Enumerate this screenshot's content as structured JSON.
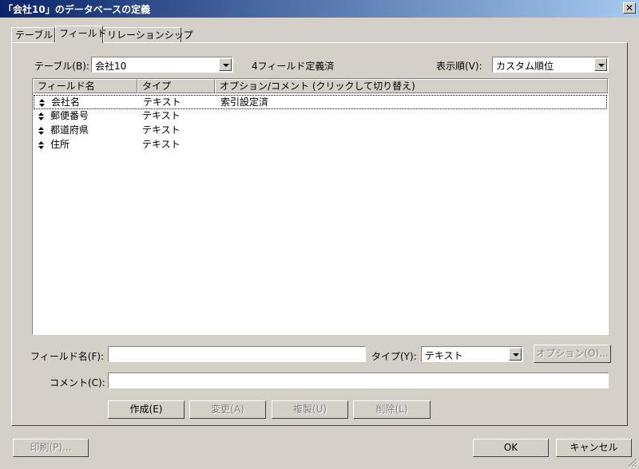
{
  "window": {
    "title": "「会社10」のデータベースの定義",
    "close_glyph": "✕"
  },
  "tabs": [
    {
      "label": "テーブル",
      "active": false
    },
    {
      "label": "フィールド",
      "active": true
    },
    {
      "label": "リレーションシップ",
      "active": false
    }
  ],
  "table_selector": {
    "label": "テーブル(B):",
    "value": "会社10"
  },
  "field_count": "4フィールド定義済",
  "sort_order": {
    "label": "表示順(V):",
    "value": "カスタム順位"
  },
  "field_list": {
    "columns": [
      "フィールド名",
      "タイプ",
      "オプション/コメント  (クリックして切り替え)"
    ],
    "rows": [
      {
        "name": "会社名",
        "type": "テキスト",
        "options": "索引設定済",
        "selected": true
      },
      {
        "name": "郵便番号",
        "type": "テキスト",
        "options": ""
      },
      {
        "name": "都道府県",
        "type": "テキスト",
        "options": ""
      },
      {
        "name": "住所",
        "type": "テキスト",
        "options": ""
      }
    ]
  },
  "field_name": {
    "label": "フィールド名(F):",
    "value": ""
  },
  "type_selector": {
    "label": "タイプ(Y):",
    "value": "テキスト"
  },
  "options_button": "オプション(O)...",
  "comment": {
    "label": "コメント(C):",
    "value": ""
  },
  "actions": {
    "create": "作成(E)",
    "change": "変更(A)",
    "duplicate": "複製(U)",
    "delete": "削除(L)"
  },
  "footer": {
    "print": "印刷(P)...",
    "ok": "OK",
    "cancel": "キャンセル"
  }
}
